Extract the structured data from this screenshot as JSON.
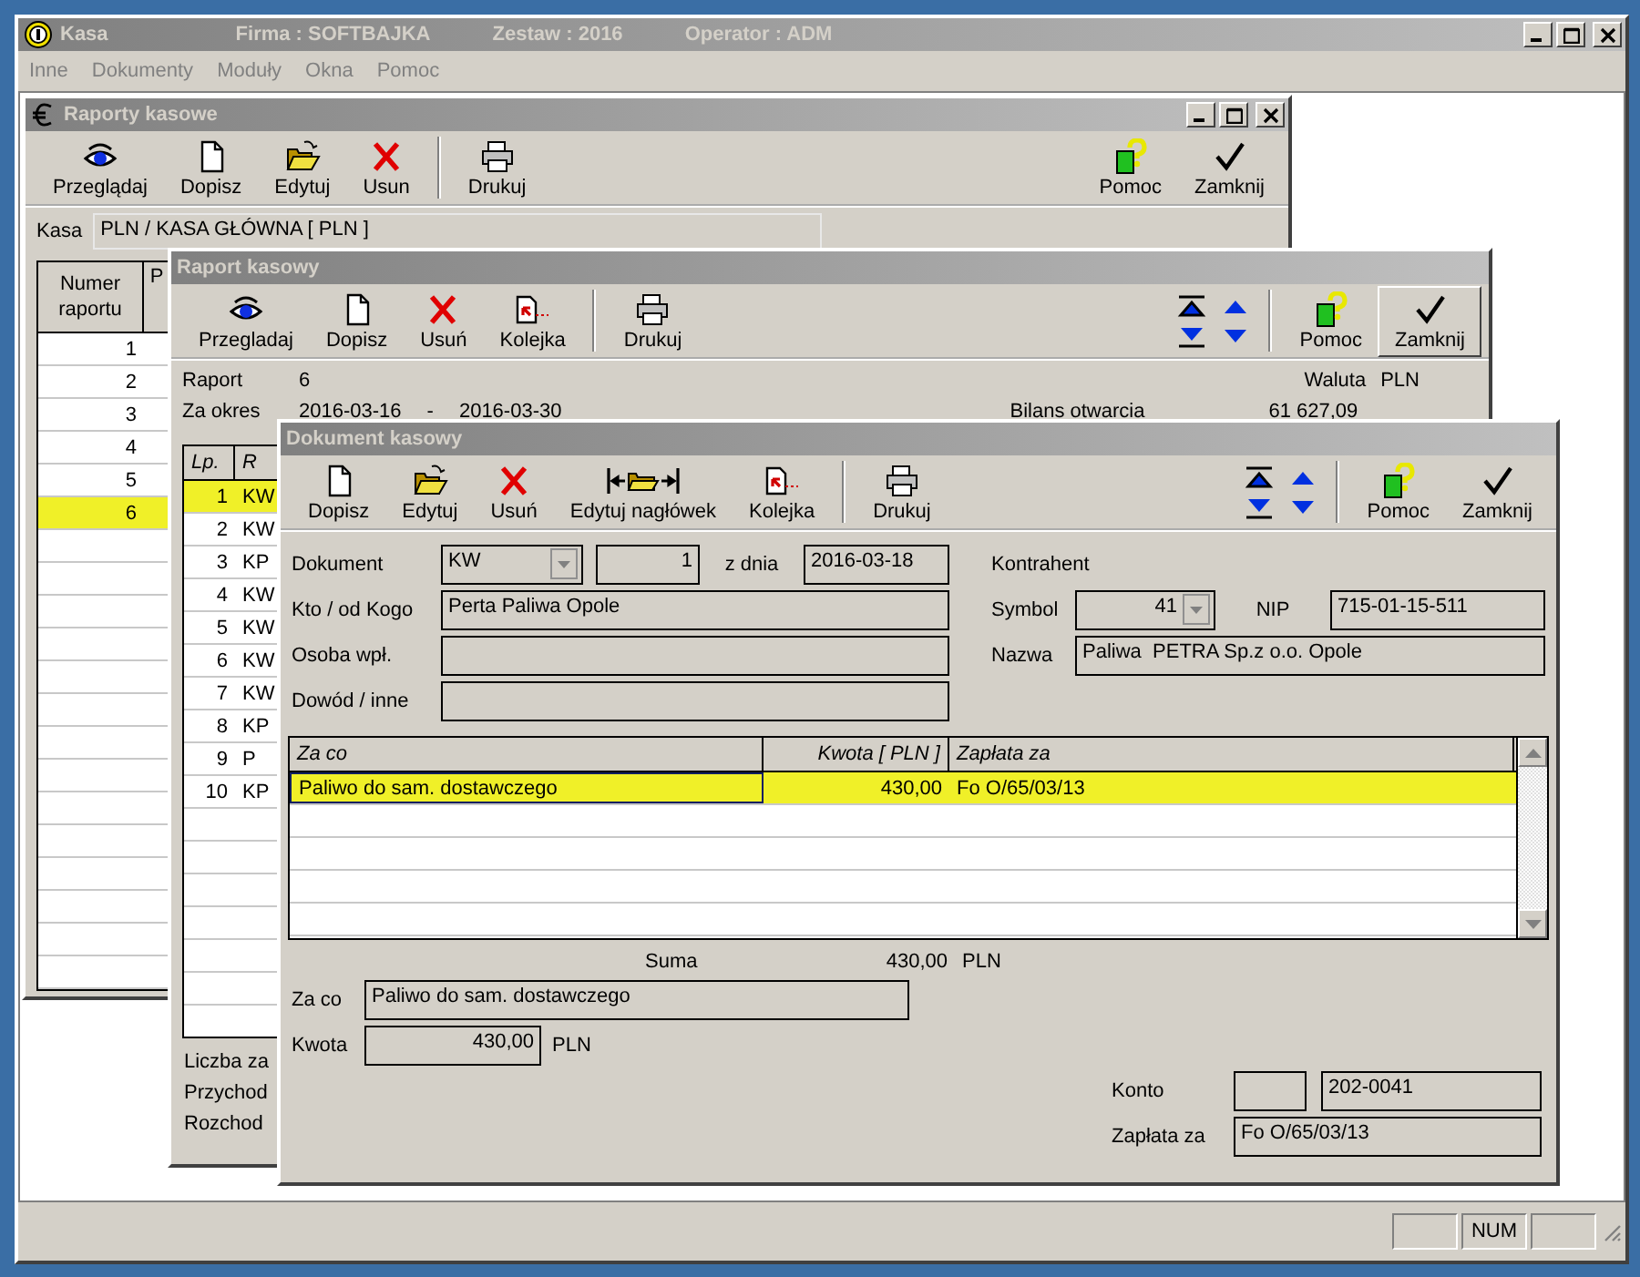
{
  "app": {
    "title": "Kasa",
    "company": "Firma : SOFTBAJKA",
    "dataset": "Zestaw : 2016",
    "operator": "Operator : ADM"
  },
  "menu": [
    "Inne",
    "Dokumenty",
    "Moduły",
    "Okna",
    "Pomoc"
  ],
  "reports_window": {
    "title": "Raporty kasowe",
    "toolbar": [
      {
        "kind": "view",
        "label": "Przeglądaj"
      },
      {
        "kind": "add",
        "label": "Dopisz"
      },
      {
        "kind": "edit",
        "label": "Edytuj"
      },
      {
        "kind": "delete",
        "label": "Usun"
      },
      {
        "kind": "print",
        "label": "Drukuj"
      }
    ],
    "toolbar_right": [
      {
        "kind": "help",
        "label": "Pomoc",
        "raised": false
      },
      {
        "kind": "close",
        "label": "Zamknij",
        "raised": false
      }
    ],
    "cash_label": "Kasa",
    "cash_value": "PLN / KASA GŁÓWNA [ PLN ]",
    "columns": [
      "Numer raportu",
      "P"
    ],
    "rows": [
      {
        "number": "1",
        "selected": false
      },
      {
        "number": "2",
        "selected": false
      },
      {
        "number": "3",
        "selected": false
      },
      {
        "number": "4",
        "selected": false
      },
      {
        "number": "5",
        "selected": false
      },
      {
        "number": "6",
        "selected": true
      }
    ]
  },
  "report_window": {
    "title": "Raport kasowy",
    "toolbar": [
      {
        "kind": "view",
        "label": "Przegladaj"
      },
      {
        "kind": "add",
        "label": "Dopisz"
      },
      {
        "kind": "delete",
        "label": "Usuń"
      },
      {
        "kind": "queue",
        "label": "Kolejka"
      },
      {
        "kind": "print",
        "label": "Drukuj"
      }
    ],
    "toolbar_right": [
      {
        "kind": "help",
        "label": "Pomoc",
        "raised": false
      },
      {
        "kind": "close",
        "label": "Zamknij",
        "raised": true
      }
    ],
    "report_label": "Raport",
    "report_number": "6",
    "currency_label": "Waluta",
    "currency": "PLN",
    "period_label": "Za okres",
    "period_from": "2016-03-16",
    "period_sep": "-",
    "period_to": "2016-03-30",
    "opening_label": "Bilans otwarcia",
    "opening_value": "61 627,09",
    "columns": [
      "Lp.",
      "R"
    ],
    "rows": [
      {
        "lp": "1",
        "type": "KW",
        "selected": true
      },
      {
        "lp": "2",
        "type": "KW",
        "selected": false
      },
      {
        "lp": "3",
        "type": "KP",
        "selected": false
      },
      {
        "lp": "4",
        "type": "KW",
        "selected": false
      },
      {
        "lp": "5",
        "type": "KW",
        "selected": false
      },
      {
        "lp": "6",
        "type": "KW",
        "selected": false
      },
      {
        "lp": "7",
        "type": "KW",
        "selected": false
      },
      {
        "lp": "8",
        "type": "KP",
        "selected": false
      },
      {
        "lp": "9",
        "type": "P",
        "selected": false
      },
      {
        "lp": "10",
        "type": "KP",
        "selected": false
      }
    ],
    "footer_labels": [
      "Liczba za",
      "Przychod",
      "Rozchod"
    ]
  },
  "document_window": {
    "title": "Dokument kasowy",
    "toolbar": [
      {
        "kind": "add",
        "label": "Dopisz"
      },
      {
        "kind": "edit",
        "label": "Edytuj"
      },
      {
        "kind": "delete",
        "label": "Usuń"
      },
      {
        "kind": "header",
        "label": "Edytuj nagłówek"
      },
      {
        "kind": "queue",
        "label": "Kolejka"
      },
      {
        "kind": "print",
        "label": "Drukuj"
      }
    ],
    "toolbar_right": [
      {
        "kind": "help",
        "label": "Pomoc",
        "raised": false
      },
      {
        "kind": "close",
        "label": "Zamknij",
        "raised": false
      }
    ],
    "doc_label": "Dokument",
    "doc_type": "KW",
    "doc_number": "1",
    "date_label": "z dnia",
    "date": "2016-03-18",
    "from_label": "Kto / od Kogo",
    "from": "Perta Paliwa Opole",
    "payer_label": "Osoba wpł.",
    "proof_label": "Dowód / inne",
    "contractor_label": "Kontrahent",
    "symbol_label": "Symbol",
    "symbol": "41",
    "nip_label": "NIP",
    "nip": "715-01-15-511",
    "name_label": "Nazwa",
    "name": "Paliwa  PETRA Sp.z o.o. Opole",
    "items": {
      "columns": [
        "Za co",
        "Kwota [ PLN ]",
        "Zapłata za"
      ],
      "rows": [
        {
          "cells": [
            "Paliwo do sam. dostawczego",
            "430,00",
            "Fo O/65/03/13"
          ],
          "selected": true
        }
      ]
    },
    "sum_label": "Suma",
    "sum": "430,00",
    "sum_currency": "PLN",
    "for_label": "Za co",
    "for": "Paliwo do sam. dostawczego",
    "amount_label": "Kwota",
    "amount": "430,00",
    "amount_currency": "PLN",
    "account_label": "Konto",
    "account": "202-0041",
    "paid_for_label": "Zapłata za",
    "paid_for": "Fo O/65/03/13"
  },
  "status_bar": {
    "num": "NUM"
  }
}
